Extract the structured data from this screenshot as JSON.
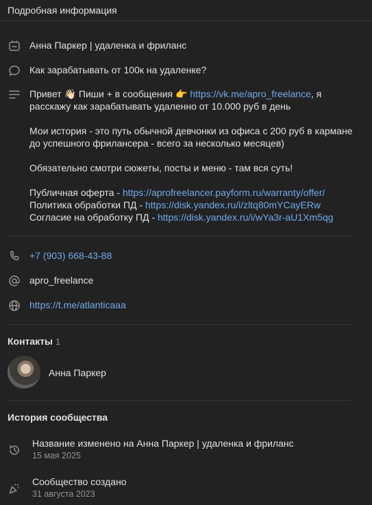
{
  "header": {
    "title": "Подробная информация"
  },
  "info": {
    "name": "Анна Паркер | удаленка и фриланс",
    "status": "Как зарабатывать от 100к на удаленке?",
    "description": {
      "l1_pre": "Привет 👋🏻 Пиши + в сообщения 👉 ",
      "l1_link": "https://vk.me/apro_freelance",
      "l1_post": ", я",
      "l2": "расскажу как зарабатывать удаленно от 10.000 руб в день",
      "l3": "Мои история - это путь обычной девчонки из офиса с 200 руб в кармане",
      "l4": "до успешного фрилансера - всего за несколько месяцев)",
      "l5": "Обязательно смотри сюжеты, посты и меню - там вся суть!",
      "l6_pre": "Публичная оферта - ",
      "l6_link": "https://aprofreelancer.payform.ru/warranty/offer/",
      "l7_pre": "Политика обработки ПД - ",
      "l7_link": "https://disk.yandex.ru/i/zltq80mYCayERw",
      "l8_pre": "Согласие на обработку ПД - ",
      "l8_link": "https://disk.yandex.ru/i/wYa3r-aU1Xm5qg"
    },
    "phone": "+7 (903) 668-43-88",
    "username": "apro_freelance",
    "website": "https://t.me/atlanticaaa"
  },
  "contacts": {
    "title": "Контакты",
    "count": "1",
    "items": [
      {
        "name": "Анна Паркер"
      }
    ]
  },
  "history": {
    "title": "История сообщества",
    "items": [
      {
        "text": "Название изменено на Анна Паркер | удаленка и фриланс",
        "date": "15 мая 2025"
      },
      {
        "text": "Сообщество создано",
        "date": "31 августа 2023"
      }
    ]
  },
  "icons": [
    "calendar-icon",
    "speech-bubble-icon",
    "text-lines-icon",
    "phone-icon",
    "at-sign-icon",
    "globe-icon",
    "history-icon",
    "party-popper-icon"
  ],
  "colors": {
    "background": "#222222",
    "text": "#e1e3e6",
    "link": "#71aaeb",
    "muted": "#939393",
    "divider": "#363738"
  }
}
